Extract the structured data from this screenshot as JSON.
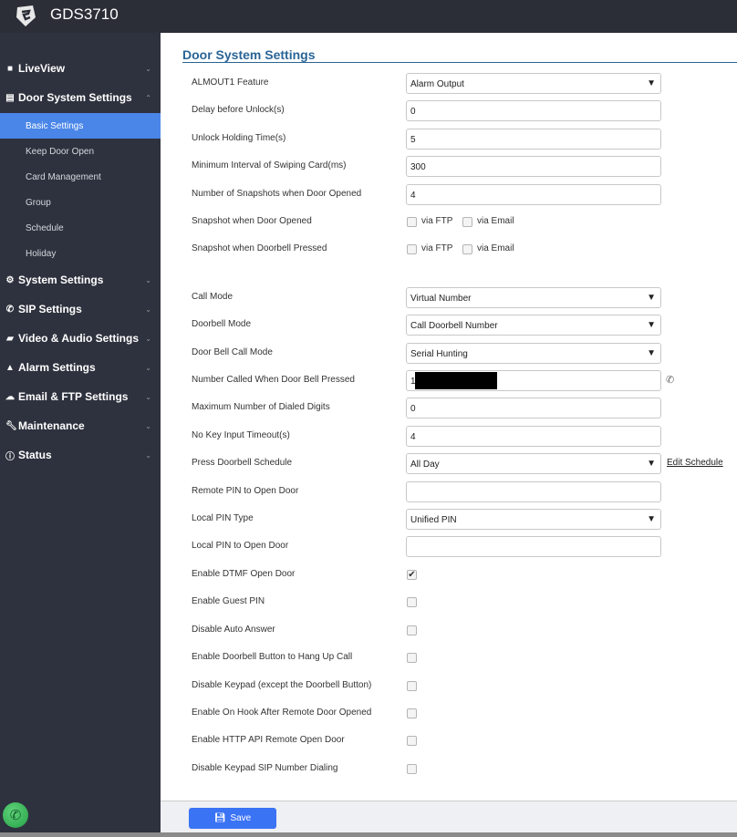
{
  "header": {
    "title": "GDS3710"
  },
  "sidebar": {
    "items": [
      {
        "label": "LiveView",
        "icon": "video-icon"
      },
      {
        "label": "Door System Settings",
        "icon": "card-icon"
      },
      {
        "label": "System Settings",
        "icon": "gears-icon"
      },
      {
        "label": "SIP Settings",
        "icon": "phone-icon"
      },
      {
        "label": "Video & Audio Settings",
        "icon": "camera-icon"
      },
      {
        "label": "Alarm Settings",
        "icon": "bell-icon"
      },
      {
        "label": "Email & FTP Settings",
        "icon": "cloud-icon"
      },
      {
        "label": "Maintenance",
        "icon": "wrench-icon"
      },
      {
        "label": "Status",
        "icon": "info-icon"
      }
    ],
    "sub_items": [
      "Basic Settings",
      "Keep Door Open",
      "Card Management",
      "Group",
      "Schedule",
      "Holiday"
    ]
  },
  "main": {
    "title": "Door System Settings",
    "fields": {
      "almout1": {
        "label": "ALMOUT1 Feature",
        "value": "Alarm Output"
      },
      "delay": {
        "label": "Delay before Unlock(s)",
        "value": "0"
      },
      "holding": {
        "label": "Unlock Holding Time(s)",
        "value": "5"
      },
      "interval": {
        "label": "Minimum Interval of Swiping Card(ms)",
        "value": "300"
      },
      "snapshots": {
        "label": "Number of Snapshots when Door Opened",
        "value": "4"
      },
      "snap_open": {
        "label": "Snapshot when Door Opened",
        "ftp": "via FTP",
        "email": "via Email"
      },
      "snap_bell": {
        "label": "Snapshot when Doorbell Pressed",
        "ftp": "via FTP",
        "email": "via Email"
      },
      "call_mode": {
        "label": "Call Mode",
        "value": "Virtual Number"
      },
      "doorbell_mode": {
        "label": "Doorbell Mode",
        "value": "Call Doorbell Number"
      },
      "bell_call_mode": {
        "label": "Door Bell Call Mode",
        "value": "Serial Hunting"
      },
      "number_called": {
        "label": "Number Called When Door Bell Pressed",
        "value": "1"
      },
      "max_digits": {
        "label": "Maximum Number of Dialed Digits",
        "value": "0"
      },
      "no_key_timeout": {
        "label": "No Key Input Timeout(s)",
        "value": "4"
      },
      "schedule": {
        "label": "Press Doorbell Schedule",
        "value": "All Day",
        "link": "Edit Schedule"
      },
      "remote_pin": {
        "label": "Remote PIN to Open Door",
        "value": ""
      },
      "local_pin_type": {
        "label": "Local PIN Type",
        "value": "Unified PIN"
      },
      "local_pin": {
        "label": "Local PIN to Open Door",
        "value": ""
      }
    },
    "checkboxes": [
      {
        "label": "Enable DTMF Open Door",
        "checked": true,
        "mark": "✔"
      },
      {
        "label": "Enable Guest PIN",
        "checked": false,
        "mark": ""
      },
      {
        "label": "Disable Auto Answer",
        "checked": false,
        "mark": ""
      },
      {
        "label": "Enable Doorbell Button to Hang Up Call",
        "checked": false,
        "mark": ""
      },
      {
        "label": "Disable Keypad (except the Doorbell Button)",
        "checked": false,
        "mark": ""
      },
      {
        "label": "Enable On Hook After Remote Door Opened",
        "checked": false,
        "mark": ""
      },
      {
        "label": "Enable HTTP API Remote Open Door",
        "checked": false,
        "mark": ""
      },
      {
        "label": "Disable Keypad SIP Number Dialing",
        "checked": false,
        "mark": ""
      }
    ]
  },
  "footer": {
    "save_label": "Save"
  },
  "colors": {
    "accent": "#4a86e8",
    "title": "#2a6496",
    "save": "#3b73f5",
    "sidebar": "#2e323e"
  }
}
